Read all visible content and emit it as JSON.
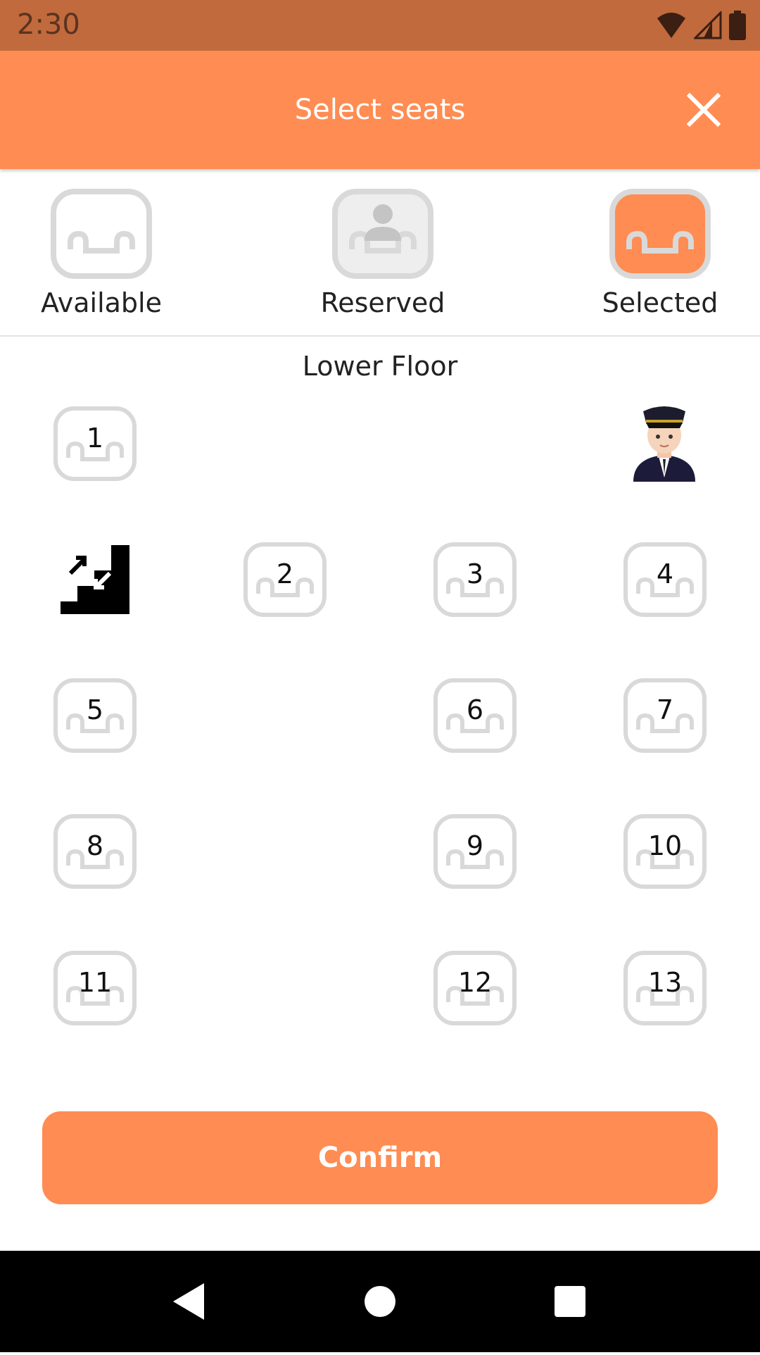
{
  "status_bar": {
    "time": "2:30",
    "icons": [
      "wifi-icon",
      "signal-icon",
      "battery-icon"
    ]
  },
  "header": {
    "title": "Select seats",
    "close_icon": "close-icon"
  },
  "legend": [
    {
      "label": "Available",
      "state": "available"
    },
    {
      "label": "Reserved",
      "state": "reserved"
    },
    {
      "label": "Selected",
      "state": "selected"
    }
  ],
  "floor": {
    "title": "Lower Floor",
    "seats": [
      "1",
      "2",
      "3",
      "4",
      "5",
      "6",
      "7",
      "8",
      "9",
      "10",
      "11",
      "12",
      "13"
    ],
    "features": [
      "driver-icon",
      "stairs-icon"
    ]
  },
  "actions": {
    "confirm_label": "Confirm"
  },
  "nav": [
    "back-icon",
    "home-icon",
    "recents-icon"
  ],
  "colors": {
    "accent": "#ff8c52",
    "status_bar": "#c06a3d",
    "seat_outline": "#d9d9d9",
    "reserved_fill": "#eeeeee"
  }
}
